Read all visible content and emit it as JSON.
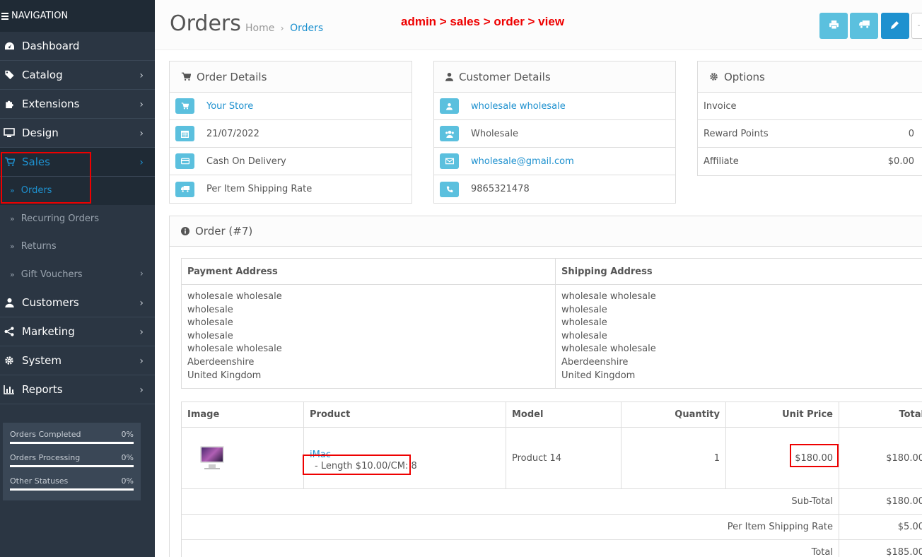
{
  "nav": {
    "header": "NAVIGATION",
    "items": [
      {
        "label": "Dashboard",
        "icon": "dashboard-icon"
      },
      {
        "label": "Catalog",
        "icon": "tags-icon"
      },
      {
        "label": "Extensions",
        "icon": "puzzle-icon"
      },
      {
        "label": "Design",
        "icon": "monitor-icon"
      },
      {
        "label": "Sales",
        "icon": "cart-icon"
      },
      {
        "label": "Customers",
        "icon": "user-icon"
      },
      {
        "label": "Marketing",
        "icon": "share-icon"
      },
      {
        "label": "System",
        "icon": "gear-icon"
      },
      {
        "label": "Reports",
        "icon": "bar-chart-icon"
      }
    ],
    "sales_sub": [
      "Orders",
      "Recurring Orders",
      "Returns",
      "Gift Vouchers"
    ]
  },
  "stats": [
    {
      "label": "Orders Completed",
      "value": "0%"
    },
    {
      "label": "Orders Processing",
      "value": "0%"
    },
    {
      "label": "Other Statuses",
      "value": "0%"
    }
  ],
  "header": {
    "title": "Orders",
    "breadcrumb": [
      "Home",
      "Orders"
    ],
    "annotation": "admin > sales > order > view"
  },
  "order_details": {
    "title": "Order Details",
    "store": "Your Store",
    "date": "21/07/2022",
    "payment": "Cash On Delivery",
    "shipping": "Per Item Shipping Rate"
  },
  "customer_details": {
    "title": "Customer Details",
    "name": "wholesale wholesale",
    "group": "Wholesale",
    "email": "wholesale@gmail.com",
    "phone": "9865321478"
  },
  "options": {
    "title": "Options",
    "rows": [
      {
        "label": "Invoice",
        "value": ""
      },
      {
        "label": "Reward Points",
        "value": "0"
      },
      {
        "label": "Affiliate",
        "value": "$0.00"
      }
    ]
  },
  "order": {
    "title": "Order (#7)",
    "payment_address_label": "Payment Address",
    "shipping_address_label": "Shipping Address",
    "payment_address": [
      "wholesale wholesale",
      "wholesale",
      "wholesale",
      "wholesale",
      "wholesale wholesale",
      "Aberdeenshire",
      "United Kingdom"
    ],
    "shipping_address": [
      "wholesale wholesale",
      "wholesale",
      "wholesale",
      "wholesale",
      "wholesale wholesale",
      "Aberdeenshire",
      "United Kingdom"
    ],
    "columns": [
      "Image",
      "Product",
      "Model",
      "Quantity",
      "Unit Price",
      "Total"
    ],
    "product": {
      "name": "iMac",
      "option": "- Length $10.00/CM: 8",
      "model": "Product 14",
      "quantity": "1",
      "unit_price": "$180.00",
      "total": "$180.00"
    },
    "totals": [
      {
        "label": "Sub-Total",
        "value": "$180.00"
      },
      {
        "label": "Per Item Shipping Rate",
        "value": "$5.00"
      },
      {
        "label": "Total",
        "value": "$185.00"
      }
    ]
  },
  "colors": {
    "accent": "#1e91cf",
    "info": "#5bc0de",
    "sidebar": "#2b3643",
    "annotation": "#ee0000"
  }
}
